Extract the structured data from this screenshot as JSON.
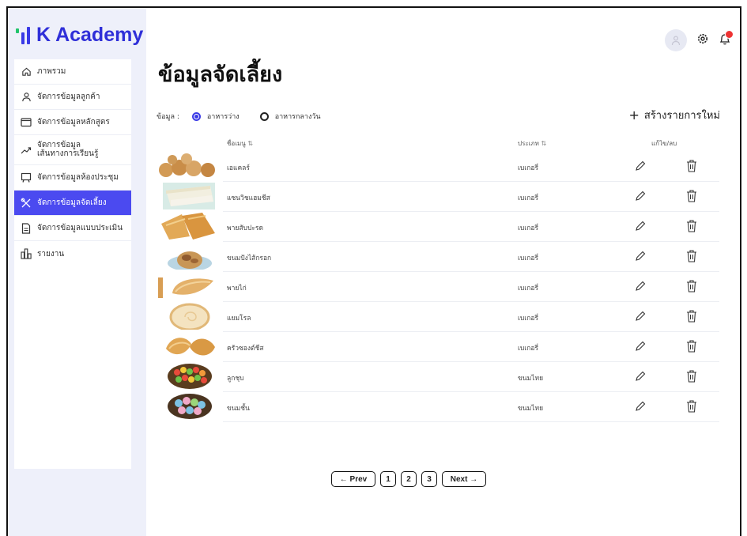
{
  "app": {
    "title": "K Academy"
  },
  "sidebar": {
    "items": [
      {
        "label": "ภาพรวม",
        "icon": "home-icon"
      },
      {
        "label": "จัดการข้อมูลลูกค้า",
        "icon": "user-icon"
      },
      {
        "label": "จัดการข้อมูลหลักสูตร",
        "icon": "folder-icon"
      },
      {
        "label": "จัดการข้อมูล\nเส้นทางการเรียนรู้",
        "icon": "trend-icon"
      },
      {
        "label": "จัดการข้อมูลห้องประชุม",
        "icon": "room-icon"
      },
      {
        "label": "จัดการข้อมูลจัดเลี้ยง",
        "icon": "utensils-icon",
        "active": true
      },
      {
        "label": "จัดการข้อมูลแบบประเมิน",
        "icon": "document-icon"
      },
      {
        "label": "รายงาน",
        "icon": "report-icon"
      }
    ]
  },
  "header": {
    "notification_color": "#e33333"
  },
  "main": {
    "title": "ข้อมูลจัดเลี้ยง",
    "filter_label": "ข้อมูล :",
    "filter_options": [
      "อาหารว่าง",
      "อาหารกลางวัน"
    ],
    "filter_selected": "อาหารว่าง",
    "create_label": "สร้างรายการใหม่"
  },
  "table": {
    "columns": {
      "name": "ชื่อเมนู",
      "type": "ประเภท",
      "actions": "แก้ไข/ลบ"
    },
    "rows": [
      {
        "name": "เอแคลร์",
        "type": "เบเกอรี่"
      },
      {
        "name": "แซนวิชแฮมชีส",
        "type": "เบเกอรี่"
      },
      {
        "name": "พายสับปะรด",
        "type": "เบเกอรี่"
      },
      {
        "name": "ขนมปังไส้กรอก",
        "type": "เบเกอรี่"
      },
      {
        "name": "พายไก่",
        "type": "เบเกอรี่"
      },
      {
        "name": "แยมโรล",
        "type": "เบเกอรี่"
      },
      {
        "name": "ครัวซองต์ชีส",
        "type": "เบเกอรี่"
      },
      {
        "name": "ลูกชุบ",
        "type": "ขนมไทย"
      },
      {
        "name": "ขนมชั้น",
        "type": "ขนมไทย"
      }
    ]
  },
  "pagination": {
    "prev_label": "← Prev",
    "pages": [
      "1",
      "2",
      "3"
    ],
    "next_label": "Next →"
  },
  "colors": {
    "accent": "#4b4af0",
    "sidebar_bg": "#eef0fa"
  }
}
